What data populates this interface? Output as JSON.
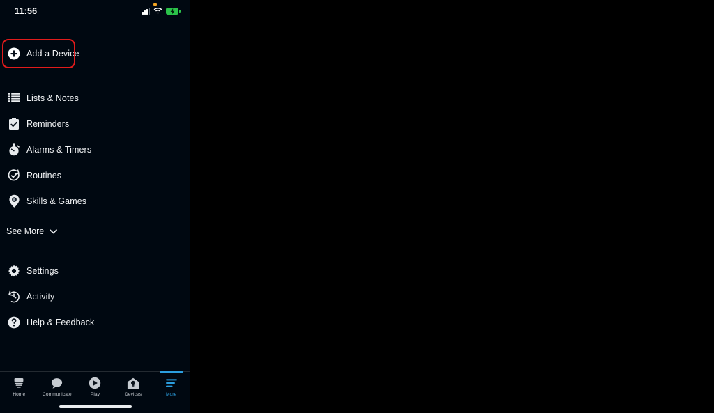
{
  "status_bar": {
    "time": "11:56",
    "privacy_indicator": "orange-dot",
    "cellular": "signal-bars-icon",
    "wifi": "wifi-icon",
    "battery": "battery-charging-icon"
  },
  "accent_colors": {
    "active_tab": "#2b9fe0",
    "highlight_box": "#e01b1b",
    "battery_green": "#2bc24a",
    "privacy_dot": "#f5a623",
    "panel_background": "#000811",
    "page_background": "#000000"
  },
  "menu": {
    "primary": [
      {
        "label": "Add a Device",
        "icon": "plus-circle-icon",
        "highlighted": true
      },
      {
        "label": "Lists & Notes",
        "icon": "list-lines-icon"
      },
      {
        "label": "Reminders",
        "icon": "clipboard-check-icon"
      },
      {
        "label": "Alarms & Timers",
        "icon": "stopwatch-icon"
      },
      {
        "label": "Routines",
        "icon": "routine-check-circle-icon"
      },
      {
        "label": "Skills & Games",
        "icon": "skills-pin-icon"
      }
    ],
    "see_more": {
      "label": "See More",
      "icon": "chevron-down-icon"
    },
    "secondary": [
      {
        "label": "Settings",
        "icon": "gear-icon"
      },
      {
        "label": "Activity",
        "icon": "clock-history-icon"
      },
      {
        "label": "Help & Feedback",
        "icon": "question-circle-icon"
      }
    ]
  },
  "bottom_nav": {
    "items": [
      {
        "label": "Home",
        "icon": "echo-device-icon",
        "active": false
      },
      {
        "label": "Communicate",
        "icon": "speech-bubble-icon",
        "active": false
      },
      {
        "label": "Play",
        "icon": "play-circle-icon",
        "active": false
      },
      {
        "label": "Devices",
        "icon": "house-bulb-icon",
        "active": false
      },
      {
        "label": "More",
        "icon": "hamburger-lines-icon",
        "active": true
      }
    ]
  }
}
